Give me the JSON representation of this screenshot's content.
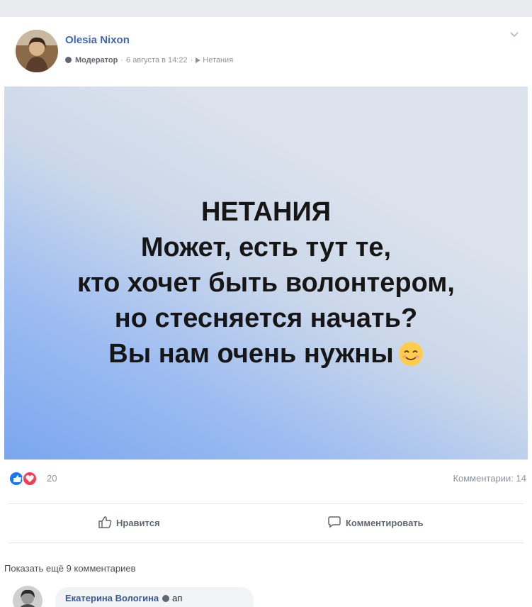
{
  "post": {
    "author": "Olesia Nixon",
    "role": "Модератор",
    "time": "6 августа в 14:22",
    "group": "Нетания",
    "image_text": {
      "line1": "НЕТАНИЯ",
      "line2": "Может, есть тут те,",
      "line3": "кто хочет быть волонтером,",
      "line4": "но стесняется начать?",
      "line5": "Вы нам очень нужны"
    },
    "reaction_count": "20",
    "comments_label": "Комментарии: 14",
    "like_label": "Нравится",
    "comment_label": "Комментировать",
    "more_comments": "Показать ещё 9 комментариев"
  },
  "comment": {
    "author": "Екатерина Вологина",
    "text": "ап"
  },
  "colors": {
    "link_blue": "#4267b2",
    "like_blue": "#1877f2",
    "love_red": "#f33e58",
    "meta_gray": "#90949c",
    "background": "#e9ebee"
  },
  "icons": [
    "avatar",
    "moderator-shield-icon",
    "group-arrow-icon",
    "options-chevron-icon",
    "like-reaction-icon",
    "love-reaction-icon",
    "thumbs-up-icon",
    "comment-bubble-icon",
    "smiling-emoji-icon"
  ]
}
